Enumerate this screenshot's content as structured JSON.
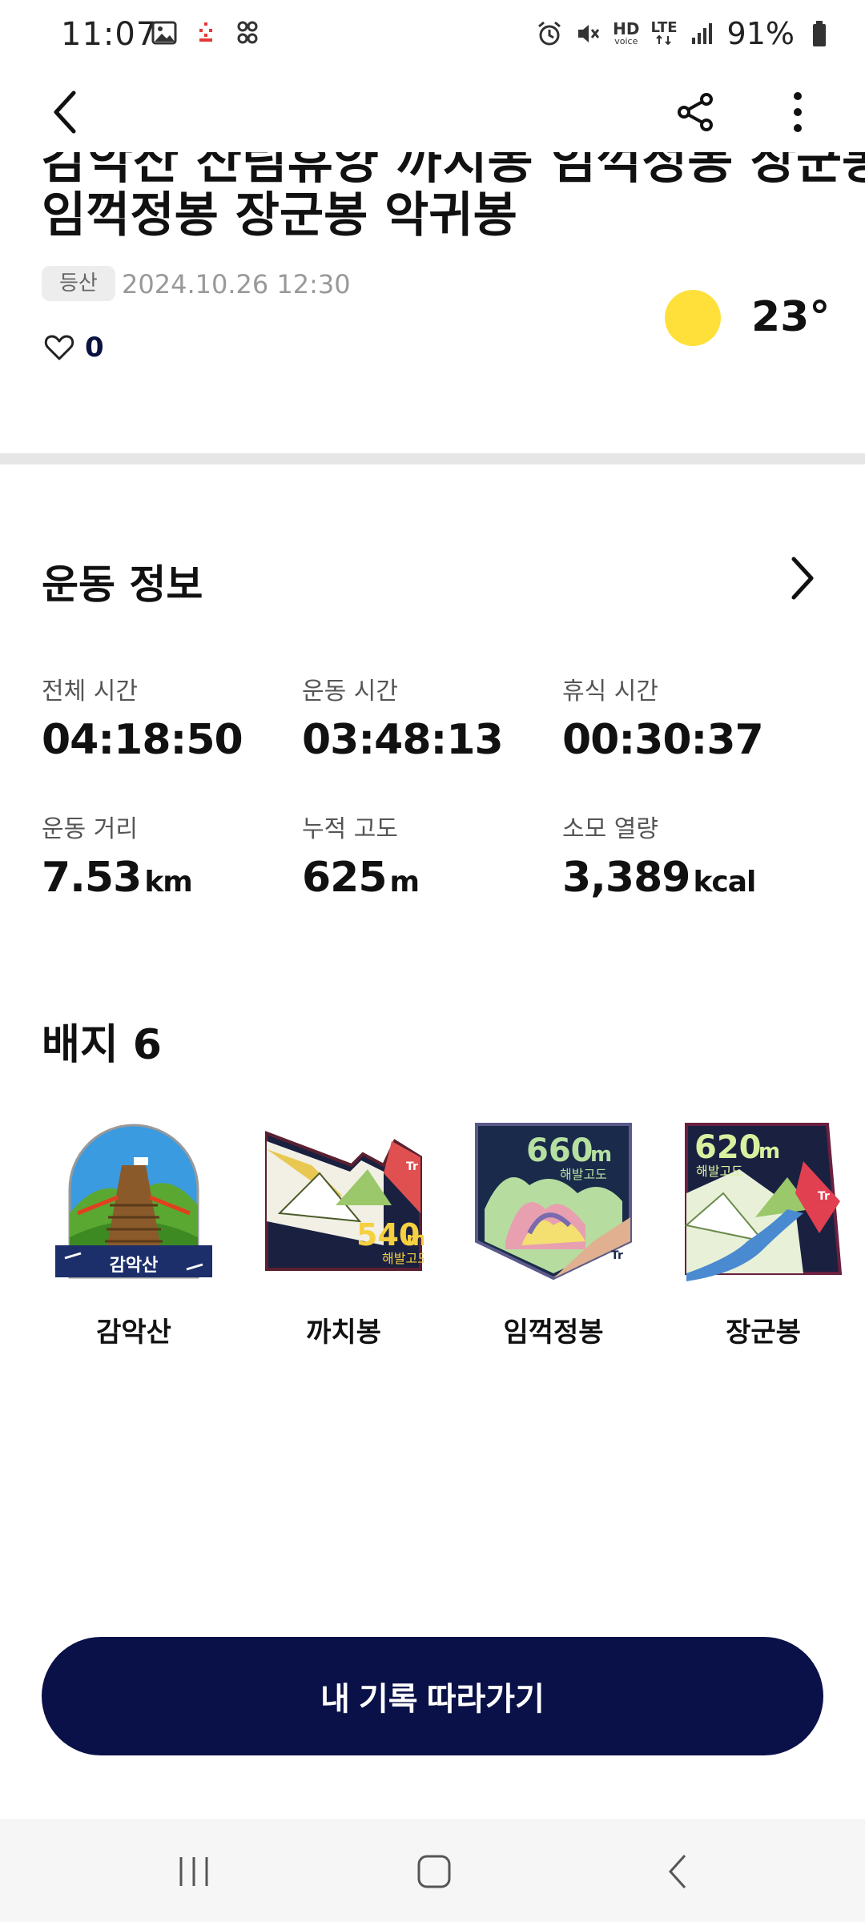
{
  "status_bar": {
    "time": "11:07",
    "battery": "91%",
    "hd_label": "HD",
    "hd_sub": "voice",
    "lte_label": "LTE"
  },
  "header": {
    "back_icon": "chevron-left-icon",
    "share_icon": "share-icon",
    "more_icon": "more-vertical-icon"
  },
  "record": {
    "title_cut_line": "감악산 산림휴양 까치봉 임꺽정봉 장군봉",
    "title_line2": "임꺽정봉 장군봉 악귀봉",
    "category": "등산",
    "datetime": "2024.10.26 12:30",
    "likes": "0",
    "temperature": "23°",
    "weather_icon": "sun-icon",
    "sun_color": "#ffe03a"
  },
  "exercise": {
    "title": "운동 정보",
    "stats": [
      {
        "label": "전체 시간",
        "value": "04:18:50",
        "unit": ""
      },
      {
        "label": "운동 시간",
        "value": "03:48:13",
        "unit": ""
      },
      {
        "label": "휴식 시간",
        "value": "00:30:37",
        "unit": ""
      },
      {
        "label": "운동 거리",
        "value": "7.53",
        "unit": "km"
      },
      {
        "label": "누적 고도",
        "value": "625",
        "unit": "m"
      },
      {
        "label": "소모 열량",
        "value": "3,389",
        "unit": "kcal"
      }
    ]
  },
  "badges": {
    "title": "배지 6",
    "items": [
      {
        "name": "감악산",
        "art_label": "감악산"
      },
      {
        "name": "까치봉",
        "altitude": "540",
        "alt_unit": "m",
        "alt_label": "해발고도"
      },
      {
        "name": "임꺽정봉",
        "altitude": "660",
        "alt_unit": "m",
        "alt_label": "해발고도"
      },
      {
        "name": "장군봉",
        "altitude": "620",
        "alt_unit": "m",
        "alt_label": "해발고도"
      }
    ]
  },
  "cta": {
    "label": "내 기록 따라가기",
    "color": "#0a1148"
  }
}
